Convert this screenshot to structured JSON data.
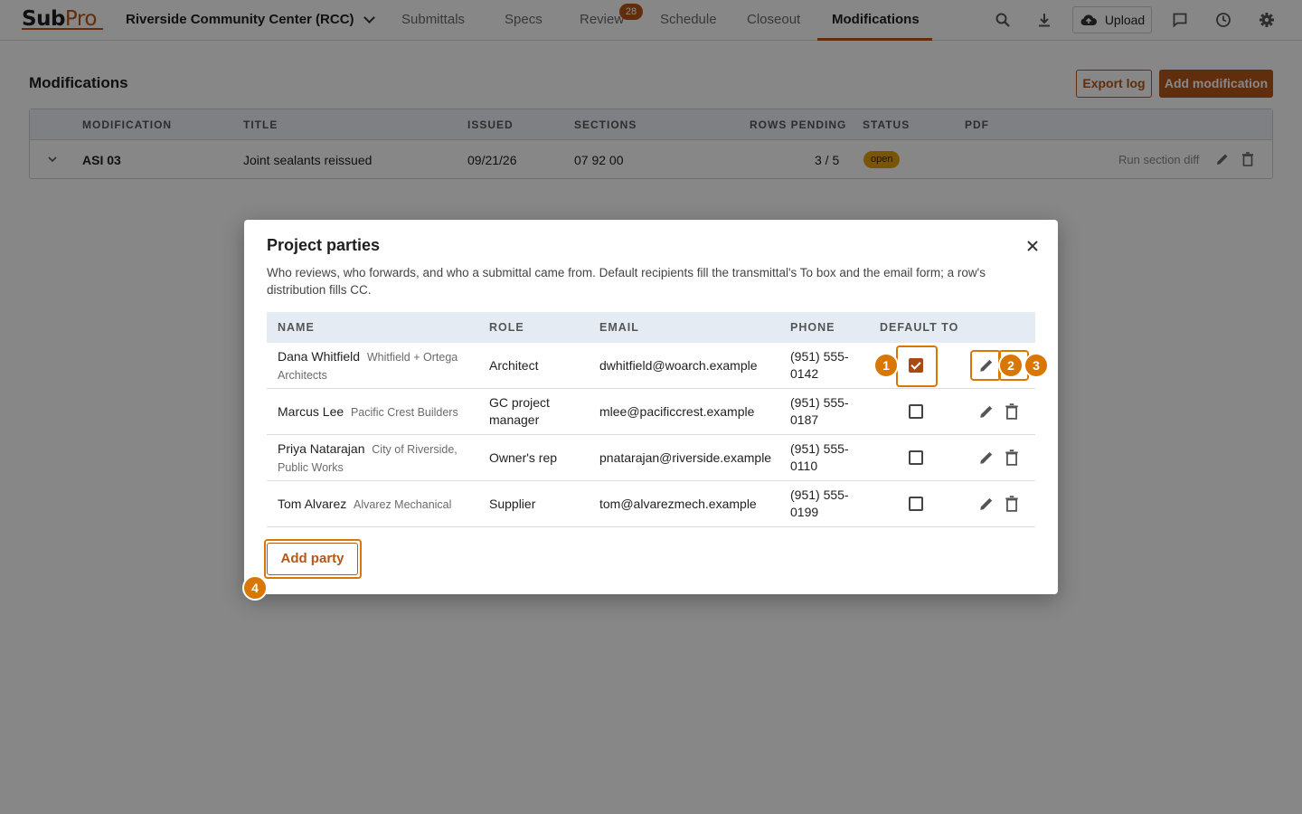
{
  "app": {
    "logo_sub": "Sub",
    "logo_pro": "Pro",
    "project": "Riverside Community Center (RCC)"
  },
  "nav": {
    "tabs": [
      "Submittals",
      "Specs",
      "Review",
      "Schedule",
      "Closeout",
      "Modifications"
    ],
    "active_tab": "Modifications",
    "review_badge": "28",
    "upload_label": "Upload"
  },
  "page": {
    "title": "Modifications",
    "export_label": "Export log",
    "add_label": "Add modification"
  },
  "mods": {
    "headers": [
      "MODIFICATION",
      "TITLE",
      "ISSUED",
      "SECTIONS",
      "ROWS PENDING",
      "STATUS",
      "PDF"
    ],
    "rows": [
      {
        "modification": "ASI 03",
        "title": "Joint sealants reissued",
        "issued": "09/21/26",
        "sections": "07 92 00",
        "rows_pending": "3 / 5",
        "status": "open",
        "action": "Run section diff"
      }
    ]
  },
  "modal": {
    "title": "Project parties",
    "description": "Who reviews, who forwards, and who a submittal came from. Default recipients fill the transmittal's To box and the email form; a row's distribution fills CC.",
    "headers": [
      "NAME",
      "ROLE",
      "EMAIL",
      "PHONE",
      "DEFAULT TO"
    ],
    "rows": [
      {
        "name": "Dana Whitfield",
        "org": "Whitfield + Ortega Architects",
        "role": "Architect",
        "email": "dwhitfield@woarch.example",
        "phone": "(951) 555-0142",
        "default_to": true
      },
      {
        "name": "Marcus Lee",
        "org": "Pacific Crest Builders",
        "role": "GC project manager",
        "email": "mlee@pacificcrest.example",
        "phone": "(951) 555-0187",
        "default_to": false
      },
      {
        "name": "Priya Natarajan",
        "org": "City of Riverside, Public Works",
        "role": "Owner's rep",
        "email": "pnatarajan@riverside.example",
        "phone": "(951) 555-0110",
        "default_to": false
      },
      {
        "name": "Tom Alvarez",
        "org": "Alvarez Mechanical",
        "role": "Supplier",
        "email": "tom@alvarezmech.example",
        "phone": "(951) 555-0199",
        "default_to": false
      }
    ],
    "add_label": "Add party"
  },
  "annotations": [
    "1",
    "2",
    "3",
    "4"
  ],
  "colors": {
    "accent": "#b5561a",
    "highlight": "#d97706",
    "status_open": "#e2a20c"
  }
}
